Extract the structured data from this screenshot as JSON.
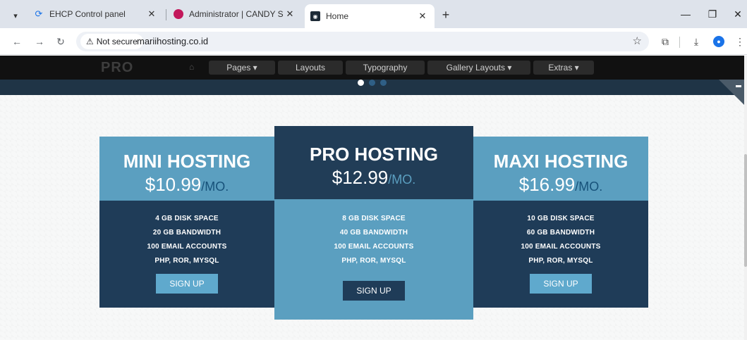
{
  "browser": {
    "tabs": [
      {
        "title": "EHCP Control panel",
        "favicon": "ehcp-icon"
      },
      {
        "title": "Administrator | CANDY SCHOO",
        "favicon": "admin-icon"
      },
      {
        "title": "Home",
        "favicon": "home-favicon"
      }
    ],
    "new_tab": "+",
    "address": {
      "security_label": "Not secure",
      "url": "mariihosting.co.id"
    }
  },
  "site": {
    "logo": "PRO",
    "nav": [
      "Pages ▾",
      "Layouts",
      "Typography",
      "Gallery Layouts ▾",
      "Extras ▾"
    ]
  },
  "plans": [
    {
      "name": "MINI HOSTING",
      "price": "$10.99",
      "per": "/MO.",
      "features": [
        "4 GB DISK SPACE",
        "20 GB BANDWIDTH",
        "100 EMAIL ACCOUNTS",
        "PHP, ROR, MYSQL"
      ],
      "button": "SIGN UP"
    },
    {
      "name": "PRO HOSTING",
      "price": "$12.99",
      "per": "/MO.",
      "features": [
        "8 GB DISK SPACE",
        "40 GB BANDWIDTH",
        "100 EMAIL ACCOUNTS",
        "PHP, ROR, MYSQL"
      ],
      "button": "SIGN UP"
    },
    {
      "name": "MAXI HOSTING",
      "price": "$16.99",
      "per": "/MO.",
      "features": [
        "10 GB DISK SPACE",
        "60 GB BANDWIDTH",
        "100 EMAIL ACCOUNTS",
        "PHP, ROR, MYSQL"
      ],
      "button": "SIGN UP"
    }
  ],
  "colors": {
    "plan_light": "#5b9fc0",
    "plan_dark": "#1f3c58",
    "nav_band": "#111111"
  }
}
